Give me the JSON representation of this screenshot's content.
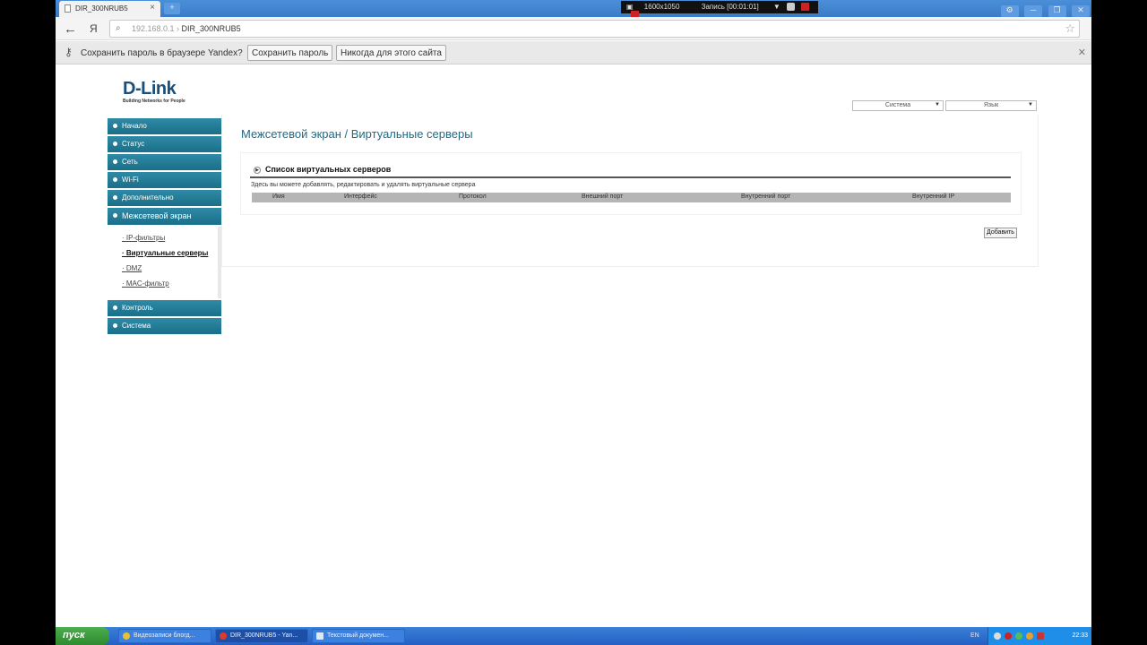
{
  "browser": {
    "tab_title": "DIR_300NRUB5",
    "tab_close": "×",
    "new_tab": "+",
    "recorder": {
      "resolution": "1600x1050",
      "status": "Запись [00:01:01]"
    },
    "url_host": "192.168.0.1",
    "url_sep": " › ",
    "url_page": "DIR_300NRUB5",
    "search_icon": "⌕",
    "bookmark_icon": "☆",
    "back_icon": "←",
    "ya_icon": "Я",
    "window_buttons": [
      "⚙",
      "─",
      "❐",
      "✕"
    ]
  },
  "password_bar": {
    "key_icon": "🔑",
    "prompt": "Сохранить пароль в браузере Yandex?",
    "save_label": "Сохранить пароль",
    "never_label": "Никогда для этого сайта",
    "close_icon": "✕"
  },
  "header": {
    "logo_text": "D-Link",
    "logo_tagline": "Building Networks for People",
    "system_select": "Система",
    "language_select": "Язык"
  },
  "menu": {
    "items": [
      {
        "label": "Начало"
      },
      {
        "label": "Статус"
      },
      {
        "label": "Сеть"
      },
      {
        "label": "Wi-Fi"
      },
      {
        "label": "Дополнительно"
      },
      {
        "label": "Межсетевой экран"
      },
      {
        "label": "Контроль"
      },
      {
        "label": "Система"
      }
    ],
    "submenu": [
      "IP-фильтры",
      "Виртуальные серверы",
      "DMZ",
      "MAC-фильтр"
    ]
  },
  "main": {
    "title": "Межсетевой экран  / Виртуальные серверы",
    "panel_title": "Список виртуальных серверов",
    "description": "Здесь вы можете добавлять, редактировать и удалять виртуальные сервера",
    "columns": [
      "Имя",
      "Интерфейс",
      "Протокол",
      "Внешний порт",
      "Внутренний порт",
      "Внутренний IP"
    ],
    "add_label": "Добавить"
  },
  "taskbar": {
    "start_label": "пуск",
    "tasks": [
      "Видеозаписи блогд...",
      "DIR_300NRUB5 - Yan...",
      "Текстовый докумен..."
    ],
    "lang": "EN",
    "clock": "22:33"
  },
  "colors": {
    "menu_accent": "#1a6f89",
    "title_color": "#1f6b86",
    "table_header": "#b5b5b5"
  }
}
